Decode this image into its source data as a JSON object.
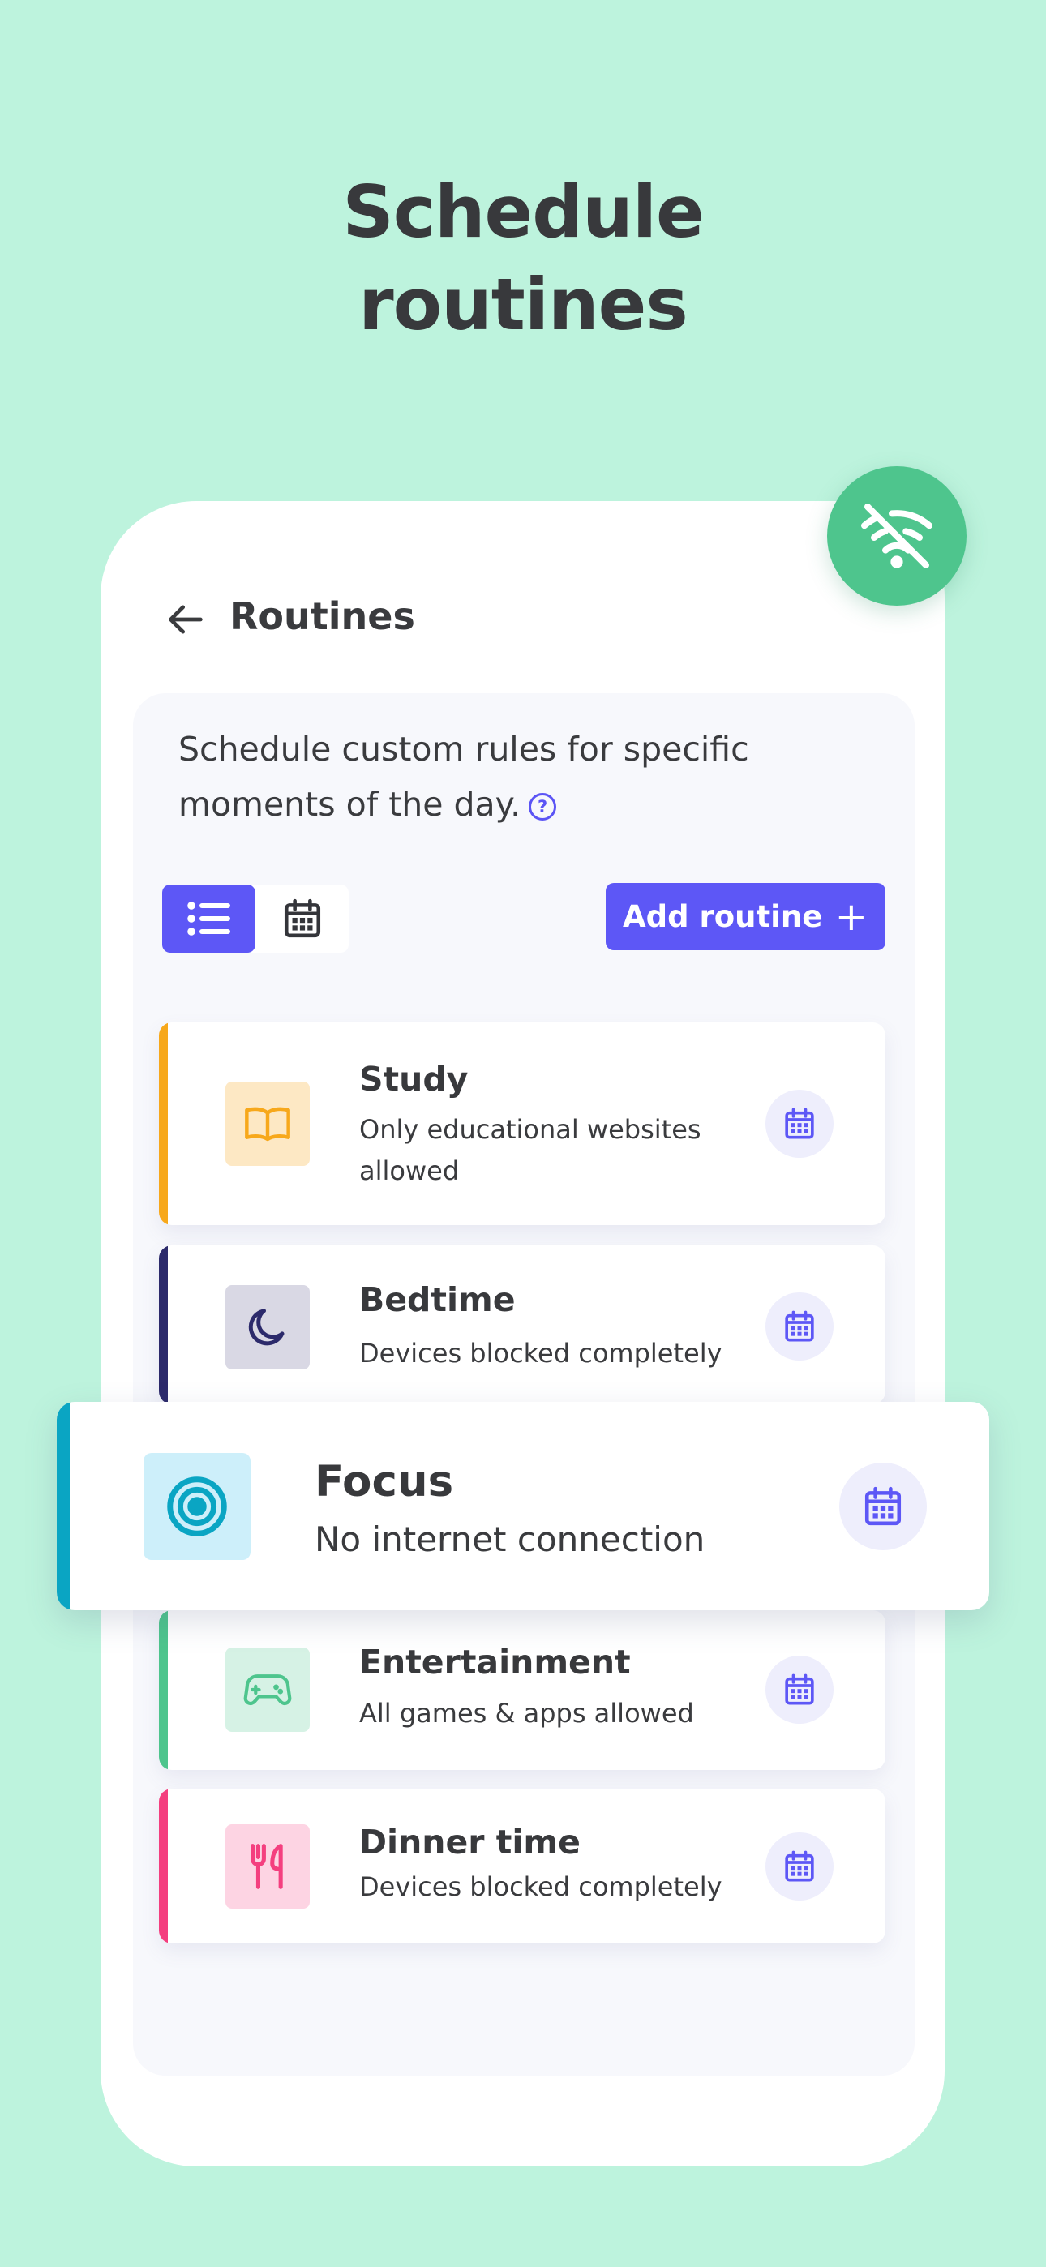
{
  "headline": {
    "line1": "Schedule",
    "line2": "routines"
  },
  "header": {
    "title": "Routines"
  },
  "intro": {
    "text": "Schedule custom rules for specific moments of the day.",
    "help_glyph": "?"
  },
  "toolbar": {
    "add_label": "Add routine",
    "add_glyph": "+"
  },
  "routines": [
    {
      "title": "Study",
      "description": "Only educational websites allowed",
      "color": "#f7a81b",
      "icon": "book-icon"
    },
    {
      "title": "Bedtime",
      "description": "Devices blocked completely",
      "color": "#2c2a6b",
      "icon": "moon-icon"
    },
    {
      "title": "Focus",
      "description": "No internet connection",
      "color": "#0aa5c3",
      "icon": "target-icon"
    },
    {
      "title": "Entertainment",
      "description": "All games & apps allowed",
      "color": "#4ec58d",
      "icon": "gamepad-icon"
    },
    {
      "title": "Dinner time",
      "description": "Devices blocked completely",
      "color": "#f43f7f",
      "icon": "cutlery-icon"
    }
  ],
  "colors": {
    "background": "#bdf3dd",
    "accent": "#5d57f6",
    "badge": "#4ec58d"
  },
  "icons": {
    "badge": "wifi-off-icon",
    "back": "arrow-left-icon",
    "list": "list-icon",
    "calendar": "calendar-icon"
  }
}
